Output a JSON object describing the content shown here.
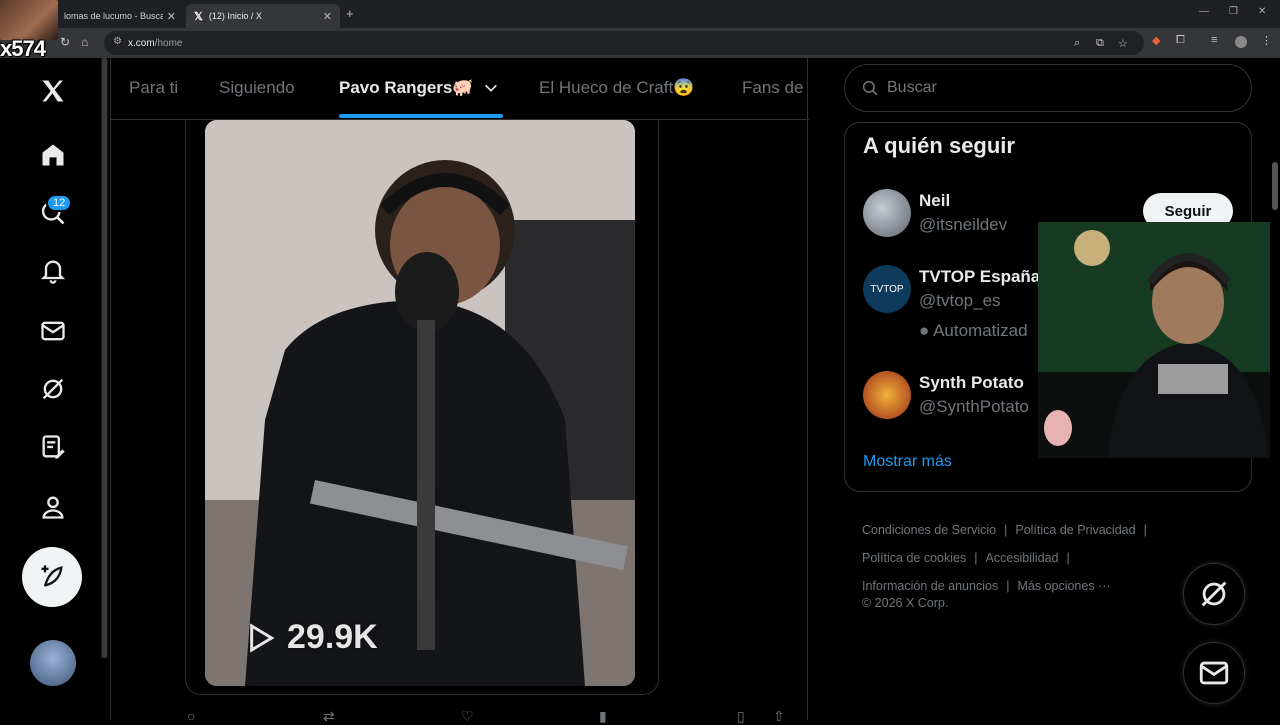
{
  "browser": {
    "tabs": [
      {
        "label": "lomas de lucumo - Buscar c",
        "active": false
      },
      {
        "label": "(12) Inicio / X",
        "active": true
      }
    ],
    "url_domain": "x.com",
    "url_path": "/home"
  },
  "overlay": {
    "streamer_tag": "x574"
  },
  "nav": {
    "items": [
      "x-logo-icon",
      "home-icon",
      "search-icon",
      "notifications-icon",
      "messages-icon",
      "grok-icon",
      "lists-icon",
      "profile-icon",
      "more-icon"
    ],
    "notification_count": "12"
  },
  "feed": {
    "tabs": [
      {
        "label": "Para ti",
        "active": false
      },
      {
        "label": "Siguiendo",
        "active": false
      },
      {
        "label": "Pavo Rangers🐖",
        "active": true
      },
      {
        "label": "El Hueco de Craft😨",
        "active": false
      },
      {
        "label": "Fans de",
        "active": false
      }
    ],
    "video_views": "29.9K"
  },
  "sidebar": {
    "search_placeholder": "Buscar",
    "who_to_follow": {
      "title": "A quién seguir",
      "accounts": [
        {
          "name": "Neil",
          "handle": "@itsneildev",
          "extra": ""
        },
        {
          "name": "TVTOP España",
          "handle": "@tvtop_es",
          "extra": "Automatizad"
        },
        {
          "name": "Synth Potato",
          "handle": "@SynthPotato",
          "extra": ""
        }
      ],
      "follow_label": "Seguir",
      "show_more": "Mostrar más"
    },
    "footer": {
      "links": [
        "Condiciones de Servicio",
        "Política de Privacidad",
        "Política de cookies",
        "Accesibilidad",
        "Información de anuncios",
        "Más opciones ···"
      ],
      "copyright": "© 2026 X Corp."
    }
  }
}
